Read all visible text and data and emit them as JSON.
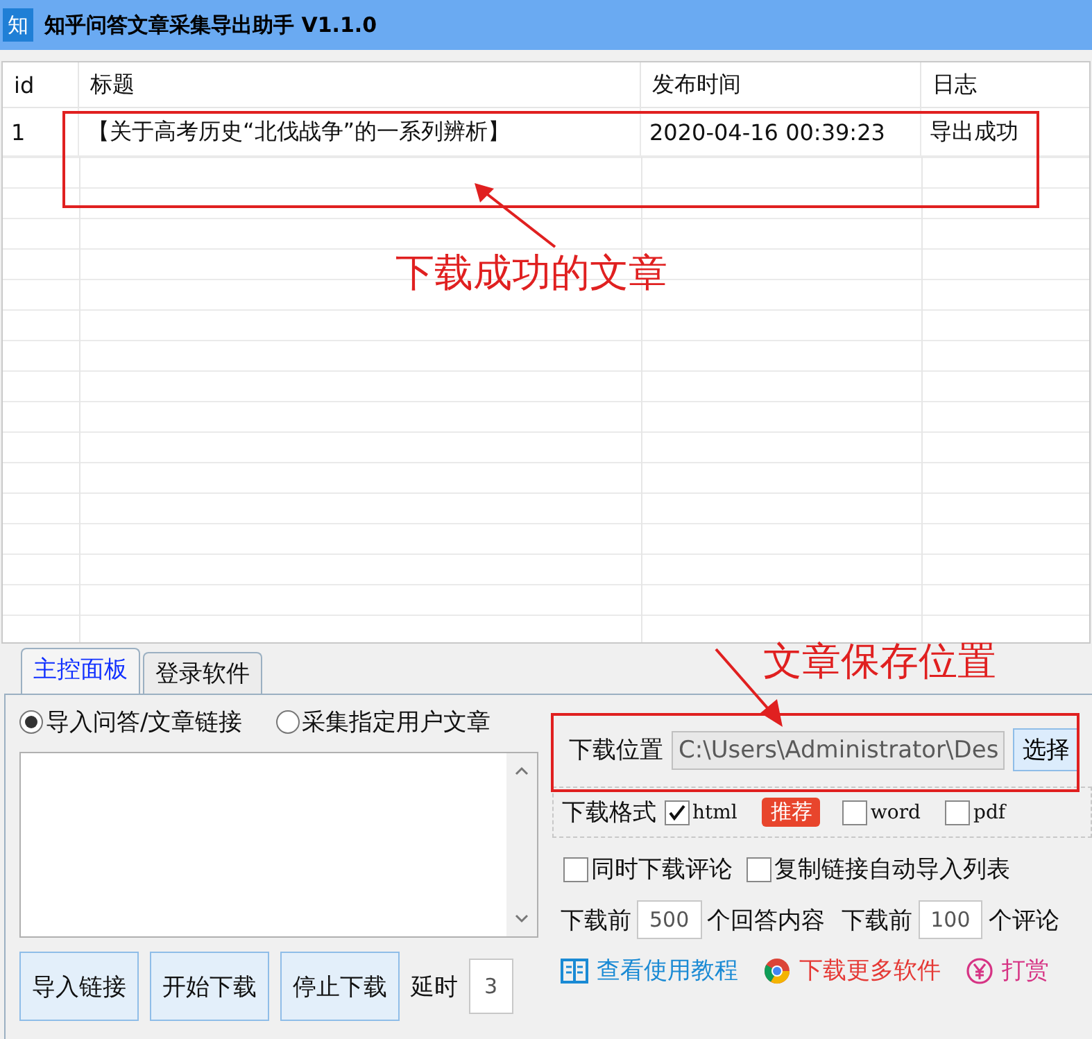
{
  "window": {
    "title": "知乎问答文章采集导出助手 V1.1.0",
    "icon": "知"
  },
  "table": {
    "columns": [
      "id",
      "标题",
      "发布时间",
      "日志"
    ],
    "rows": [
      [
        "1",
        "【关于高考历史“北伐战争”的一系列辨析】",
        "2020-04-16 00:39:23",
        "导出成功"
      ]
    ]
  },
  "annotations": [
    {
      "kind": "row",
      "text": "下载成功的文章"
    },
    {
      "kind": "location",
      "text": "文章保存位置"
    }
  ],
  "tabs": [
    {
      "label": "主控面板",
      "selected": true
    },
    {
      "label": "登录软件",
      "selected": false
    }
  ],
  "source_options": [
    {
      "label": "导入问答/文章链接",
      "selected": true
    },
    {
      "label": "采集指定用户文章",
      "selected": false
    }
  ],
  "buttons": [
    "导入链接",
    "开始下载",
    "停止下载"
  ],
  "delay": {
    "label": "延时",
    "value": "3"
  },
  "download_location": {
    "label": "下载位置",
    "value": "C:\\Users\\Administrator\\Des",
    "button": "选择"
  },
  "format": {
    "label": "下载格式",
    "badge": "推荐",
    "options": [
      {
        "label": "html",
        "checked": true
      },
      {
        "label": "word",
        "checked": false
      },
      {
        "label": "pdf",
        "checked": false
      }
    ]
  },
  "options": [
    {
      "label": "同时下载评论",
      "checked": false
    },
    {
      "label": "复制链接自动导入列表",
      "checked": false
    }
  ],
  "limits": [
    {
      "before": "下载前",
      "value": "500",
      "after": "个回答内容"
    },
    {
      "before": "下载前",
      "value": "100",
      "after": "个评论"
    }
  ],
  "links": [
    {
      "kind": "book",
      "text": "查看使用教程"
    },
    {
      "kind": "browser",
      "text": "下载更多软件"
    },
    {
      "kind": "yen",
      "text": "打赏"
    }
  ]
}
